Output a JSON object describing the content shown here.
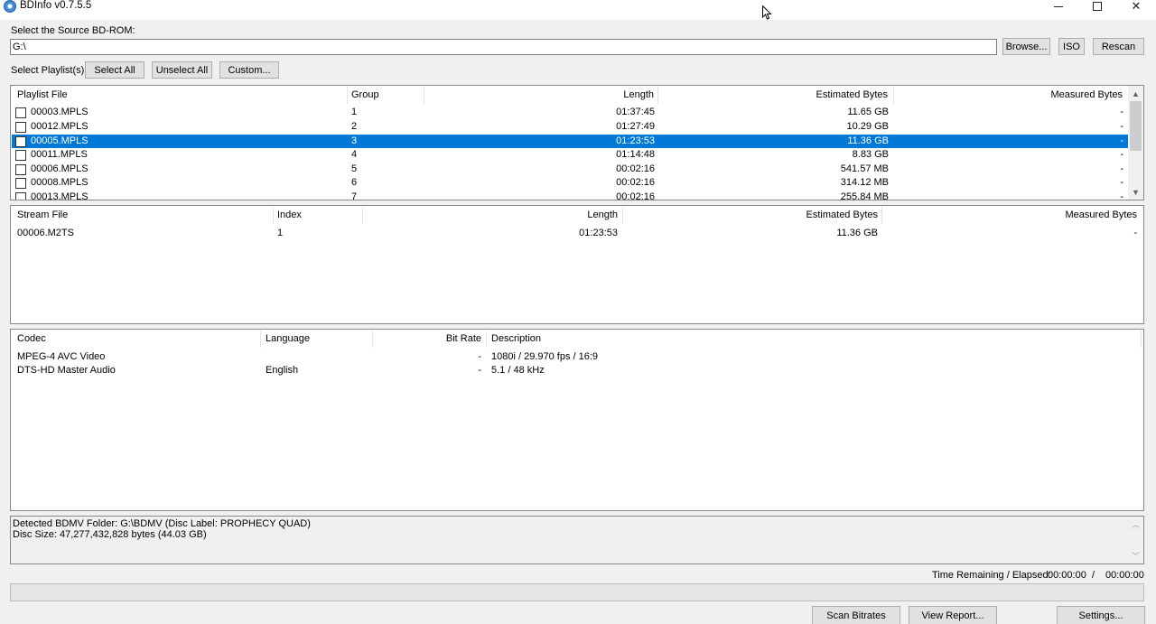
{
  "window": {
    "title": "BDInfo v0.7.5.5",
    "minimize": "—",
    "maximize": "☐",
    "close": "✕"
  },
  "source": {
    "label": "Select the Source BD-ROM:",
    "path": "G:\\",
    "browse": "Browse...",
    "iso": "ISO",
    "rescan": "Rescan"
  },
  "playlist_controls": {
    "label": "Select Playlist(s):",
    "select_all": "Select All",
    "unselect_all": "Unselect All",
    "custom": "Custom..."
  },
  "playlists": {
    "columns": [
      "Playlist File",
      "Group",
      "Length",
      "Estimated Bytes",
      "Measured Bytes"
    ],
    "rows": [
      [
        "00003.MPLS",
        "1",
        "01:37:45",
        "11.65 GB",
        "-"
      ],
      [
        "00012.MPLS",
        "2",
        "01:27:49",
        "10.29 GB",
        "-"
      ],
      [
        "00005.MPLS",
        "3",
        "01:23:53",
        "11.36 GB",
        "-"
      ],
      [
        "00011.MPLS",
        "4",
        "01:14:48",
        "8.83 GB",
        "-"
      ],
      [
        "00006.MPLS",
        "5",
        "00:02:16",
        "541.57 MB",
        "-"
      ],
      [
        "00008.MPLS",
        "6",
        "00:02:16",
        "314.12 MB",
        "-"
      ],
      [
        "00013.MPLS",
        "7",
        "00:02:16",
        "255.84 MB",
        "-"
      ]
    ],
    "selected_index": 2
  },
  "streams": {
    "columns": [
      "Stream File",
      "Index",
      "Length",
      "Estimated Bytes",
      "Measured Bytes"
    ],
    "rows": [
      [
        "00006.M2TS",
        "1",
        "01:23:53",
        "11.36 GB",
        "-"
      ]
    ]
  },
  "codecs": {
    "columns": [
      "Codec",
      "Language",
      "Bit Rate",
      "Description"
    ],
    "rows": [
      [
        "MPEG-4 AVC Video",
        "",
        "-",
        "1080i / 29.970 fps / 16:9"
      ],
      [
        "DTS-HD Master Audio",
        "English",
        "-",
        "5.1 / 48 kHz"
      ]
    ]
  },
  "log": {
    "lines": [
      "Detected BDMV Folder: G:\\BDMV (Disc Label: PROPHECY QUAD)",
      "Disc Size: 47,277,432,828 bytes (44.03 GB)"
    ]
  },
  "status": {
    "label": "Time Remaining / Elapsed:",
    "remaining": "00:00:00",
    "divider": "/",
    "elapsed": "00:00:00",
    "progress": 0
  },
  "actions": {
    "scan_bitrates": "Scan Bitrates",
    "view_report": "View Report...",
    "settings": "Settings..."
  },
  "colors": {
    "selection": "#0078d7",
    "window_bg": "#f0f0f0"
  }
}
